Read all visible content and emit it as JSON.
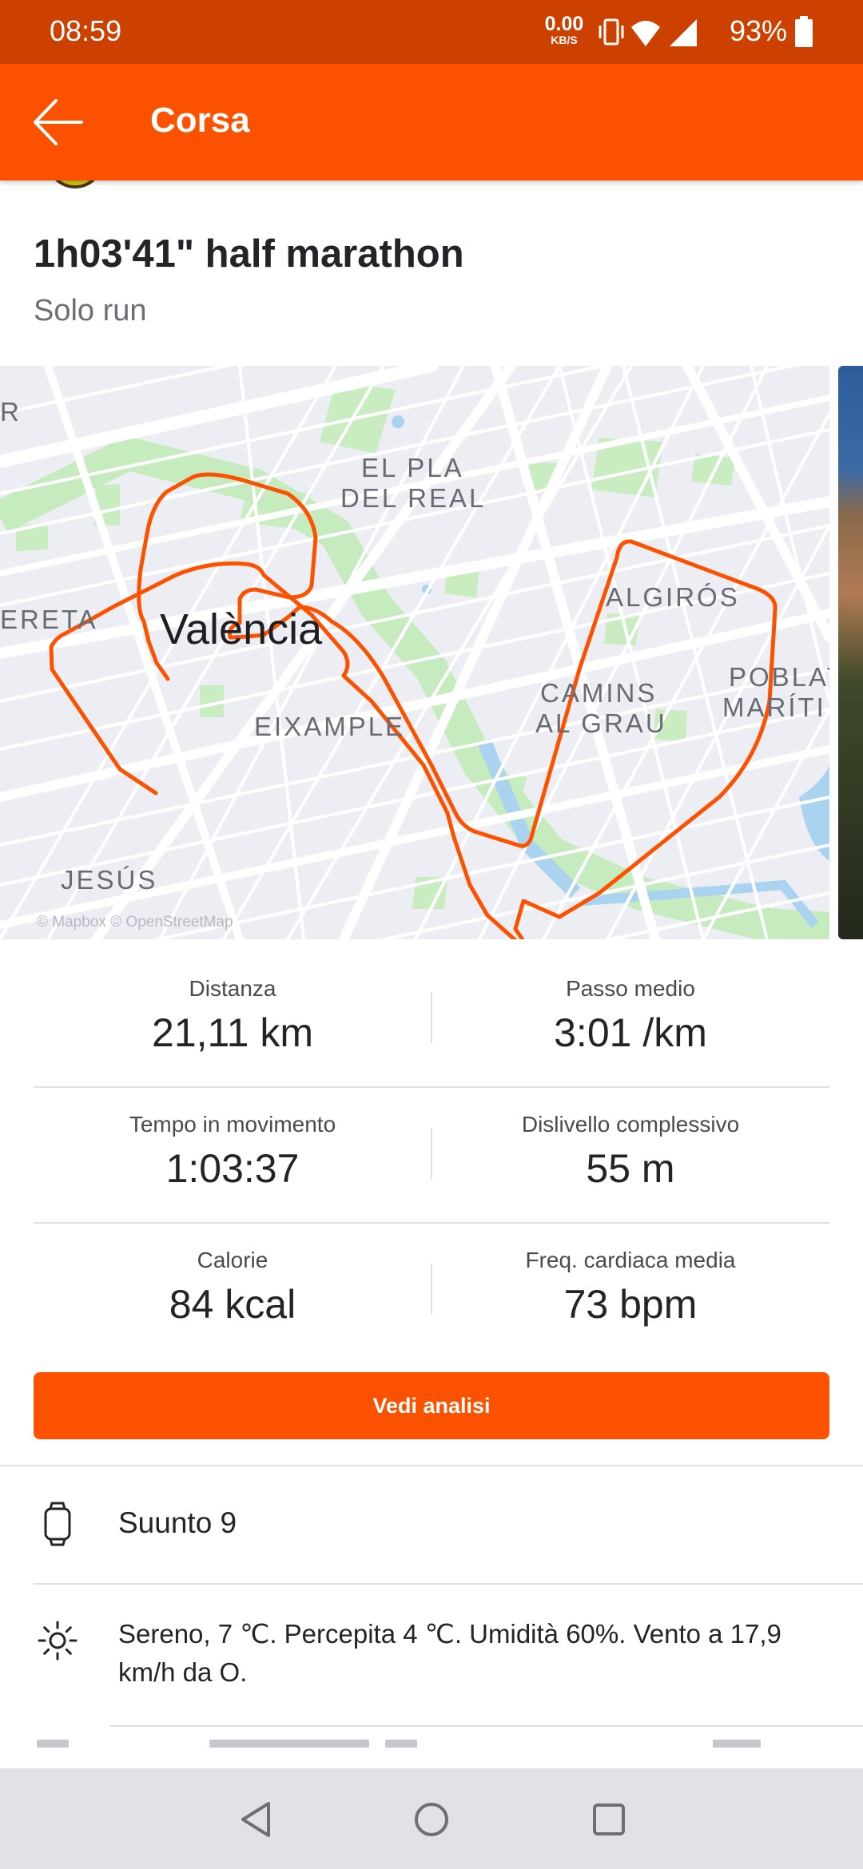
{
  "status_bar": {
    "time": "08:59",
    "net_speed_value": "0.00",
    "net_speed_unit": "KB/S",
    "battery_percent": "93%"
  },
  "app_bar": {
    "title": "Corsa",
    "back_icon": "arrow-left-icon"
  },
  "activity": {
    "title": "1h03'41\" half marathon",
    "subtitle": "Solo run"
  },
  "map": {
    "labels": {
      "el_pla": "EL PLA",
      "del_real": "DEL REAL",
      "algiros": "ALGIRÓS",
      "ereta": "ERETA",
      "city": "València",
      "camins": "CAMINS",
      "al_grau": "AL GRAU",
      "poblat": "POBLAT",
      "maritim": "MARÍTI",
      "eixample": "EIXAMPLE",
      "jesus": "JESÚS",
      "r_edge": "R"
    },
    "credit": "© Mapbox © OpenStreetMap",
    "route_color": "#fc5200"
  },
  "stats": {
    "distance": {
      "label": "Distanza",
      "value": "21,11 km"
    },
    "pace": {
      "label": "Passo medio",
      "value": "3:01 /km"
    },
    "moving_time": {
      "label": "Tempo in movimento",
      "value": "1:03:37"
    },
    "elevation": {
      "label": "Dislivello complessivo",
      "value": "55 m"
    },
    "calories": {
      "label": "Calorie",
      "value": "84 kcal"
    },
    "heart_rate": {
      "label": "Freq. cardiaca media",
      "value": "73 bpm"
    }
  },
  "analyze_button": {
    "label": "Vedi analisi"
  },
  "device": {
    "icon": "smartwatch-icon",
    "name": "Suunto 9"
  },
  "weather": {
    "icon": "sun-icon",
    "text": "Sereno, 7 ℃. Percepita 4 ℃. Umidità 60%. Vento a 17,9 km/h da O."
  },
  "colors": {
    "brand": "#fc5200",
    "status_bar": "#cc4100",
    "nav_bar": "#e2e2e6"
  },
  "nav_bar": {
    "back": "triangle-back-icon",
    "home": "circle-home-icon",
    "recents": "square-recents-icon"
  }
}
